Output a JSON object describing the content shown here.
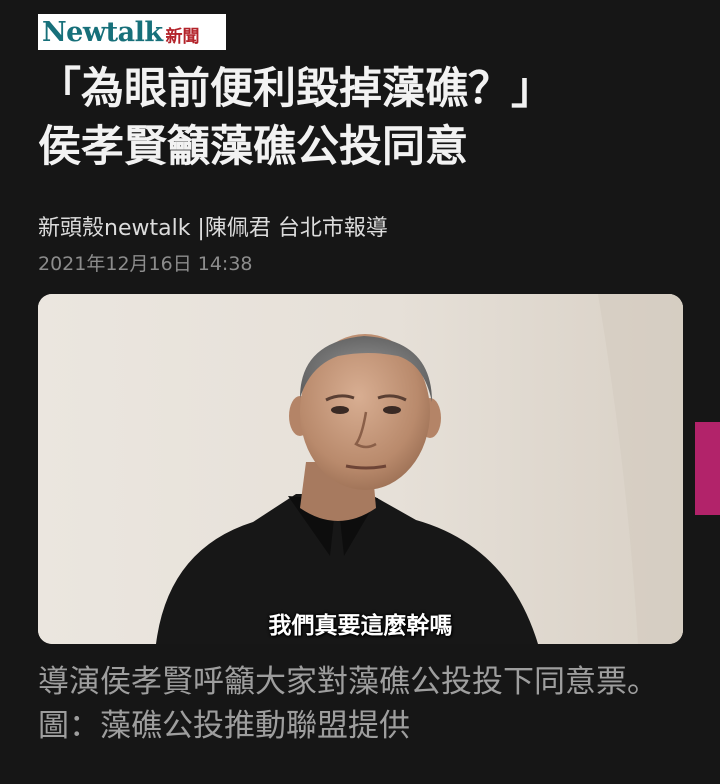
{
  "brand": {
    "name": "Newtalk",
    "suffix": "新聞",
    "colors": {
      "name": "#17707a",
      "suffix": "#b3232a"
    }
  },
  "article": {
    "headline_line1": "「為眼前便利毀掉藻礁？」",
    "headline_line2": "侯孝賢籲藻礁公投同意",
    "byline": "新頭殼newtalk |陳佩君 台北市報導",
    "timestamp": "2021年12月16日 14:38",
    "video_subtitle": "我們真要這麼幹嗎",
    "caption": "導演侯孝賢呼籲大家對藻礁公投投下同意票。 圖：藻礁公投推動聯盟提供"
  },
  "theme": {
    "background": "#161616",
    "side_tab": "#b2236a"
  }
}
